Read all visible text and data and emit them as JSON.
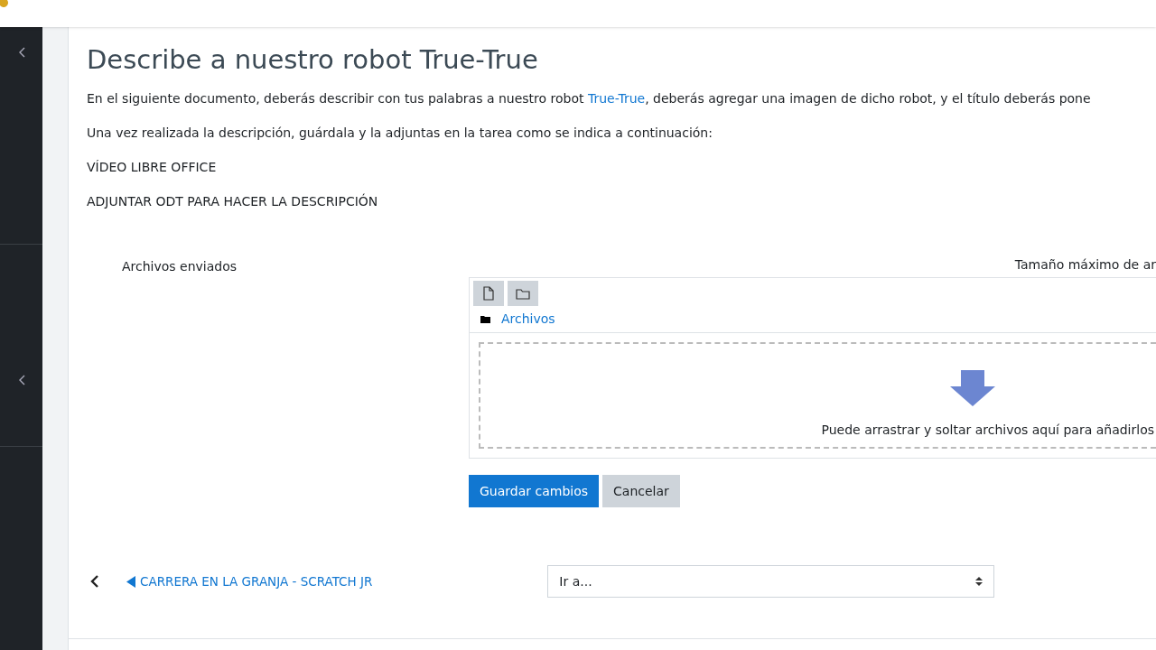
{
  "title": "Describe a nuestro robot True-True",
  "intro": {
    "before": "En el siguiente documento, deberás describir con tus palabras a nuestro robot ",
    "link": "True-True",
    "after": ", deberás agregar una imagen de dicho robot, y el título deberás pone"
  },
  "paragraphs": [
    "Una vez realizada la descripción, guárdala y la adjuntas en la tarea como se indica a continuación:",
    "VÍDEO LIBRE OFFICE",
    "ADJUNTAR ODT PARA HACER LA DESCRIPCIÓN"
  ],
  "form": {
    "label": "Archivos enviados",
    "max_size": "Tamaño máximo de ar",
    "folder": "Archivos",
    "drop_hint": "Puede arrastrar y soltar archivos aquí para añadirlos"
  },
  "buttons": [
    {
      "label": "Guardar cambios",
      "kind": "primary"
    },
    {
      "label": "Cancelar",
      "kind": "secondary"
    }
  ],
  "nav": {
    "prev": "CARRERA EN LA GRANJA - SCRATCH JR",
    "jump": "Ir a..."
  }
}
